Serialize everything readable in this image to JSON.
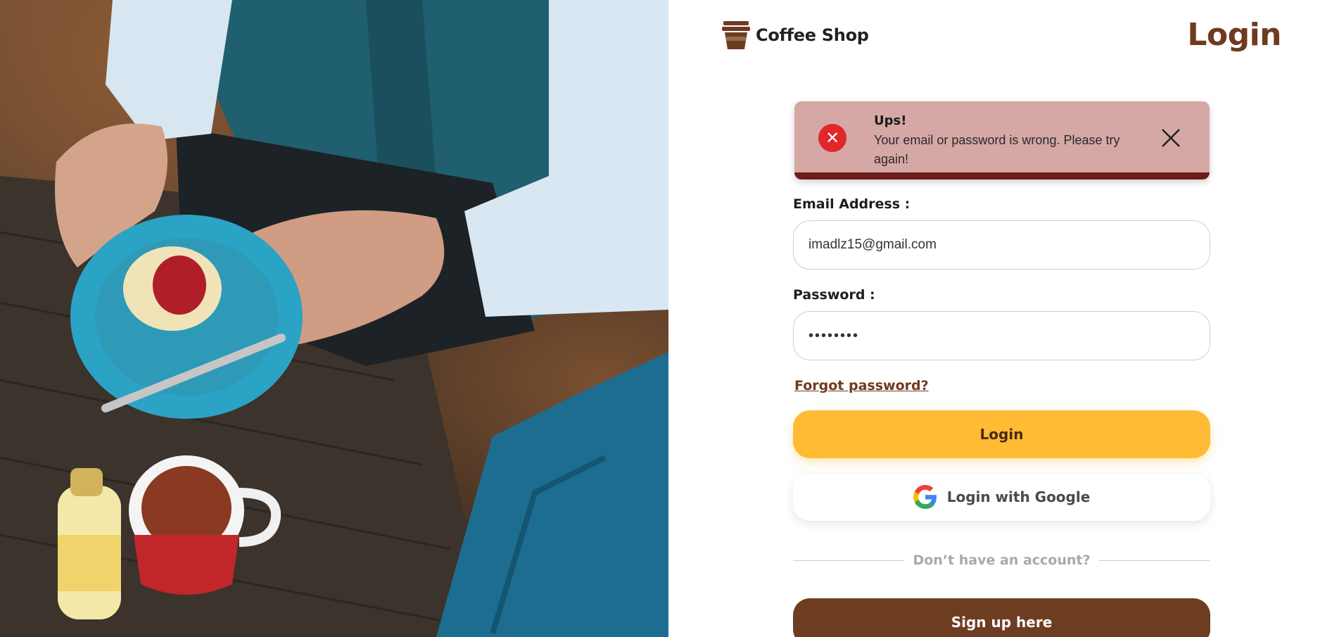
{
  "brand": {
    "name": "Coffee Shop",
    "icon": "coffee-cup-icon"
  },
  "page": {
    "title": "Login"
  },
  "alert": {
    "icon": "error-icon",
    "title": "Ups!",
    "message": "Your email or password is wrong. Please try again!",
    "close_icon": "close-icon"
  },
  "form": {
    "email": {
      "label": "Email Address :",
      "value": "imadlz15@gmail.com"
    },
    "password": {
      "label": "Password :",
      "value": "••••••••"
    },
    "forgot_link": "Forgot password?",
    "login_button": "Login",
    "google_button": "Login with Google",
    "divider_text": "Don’t have an account?",
    "signup_button": "Sign up here"
  },
  "colors": {
    "brand_brown": "#6f3b1f",
    "accent_yellow": "#ffbb33",
    "alert_bg": "#d5a8a5",
    "alert_bar": "#6a1e1a",
    "error_red": "#e2262b",
    "signup_brown": "#6d3d21"
  }
}
